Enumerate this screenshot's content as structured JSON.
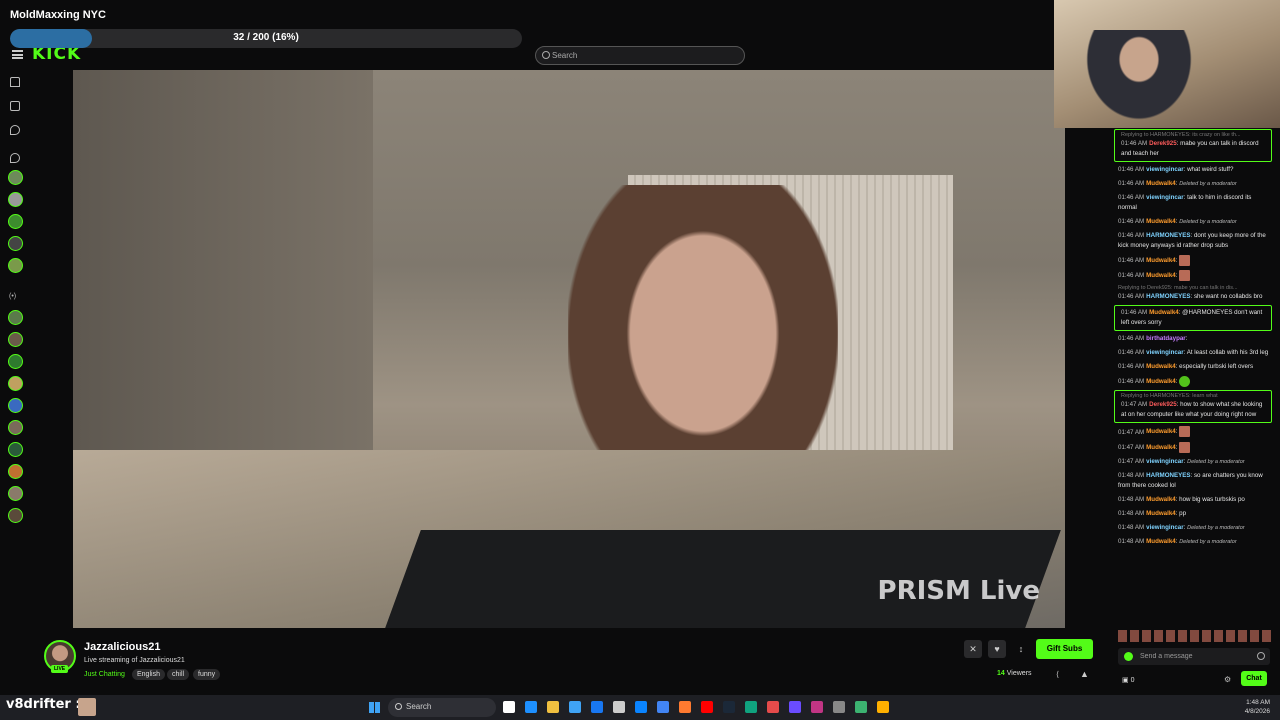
{
  "overlay": {
    "title": "MoldMaxxing NYC",
    "goal_text": "32 / 200 (16%)",
    "goal_progress": 0.16
  },
  "header": {
    "logo": "KICK",
    "search_placeholder": "Search"
  },
  "sidebar": {
    "live_label": "(•)"
  },
  "video": {
    "watermark": "PRISM Live"
  },
  "streamer": {
    "name": "Jazzalicious21",
    "live_badge": "LIVE",
    "title": "Live streaming of Jazzalicious21",
    "category": "Just Chatting",
    "tags": [
      "English",
      "chill",
      "funny"
    ],
    "gift_button": "Gift Subs",
    "viewers_count": "14",
    "viewers_label": "Viewers"
  },
  "chat": {
    "messages": [
      {
        "reply": "Replying to HARMONEYES: its crazy on like th...",
        "ts": "01:46 AM",
        "user": "Derek925",
        "color": "#ff5c5c",
        "text": ": mabe you can talk in discord and teach her",
        "hl": true
      },
      {
        "ts": "01:46 AM",
        "user": "viewingincar",
        "color": "#7fd3ff",
        "text": ": what weird stuff?"
      },
      {
        "ts": "01:46 AM",
        "user": "Mudwalk4",
        "color": "#ff9d2e",
        "text": ":",
        "deleted": "Deleted by a moderator"
      },
      {
        "ts": "01:46 AM",
        "user": "viewingincar",
        "color": "#7fd3ff",
        "text": ": talk to him in discord its normal"
      },
      {
        "ts": "01:46 AM",
        "user": "Mudwalk4",
        "color": "#ff9d2e",
        "text": ":",
        "deleted": "Deleted by a moderator"
      },
      {
        "ts": "01:46 AM",
        "user": "HARMONEYES",
        "color": "#7fd3ff",
        "text": ": dont you keep more of the kick money anyways id rather drop subs"
      },
      {
        "ts": "01:46 AM",
        "user": "Mudwalk4",
        "color": "#ff9d2e",
        "text": ":",
        "emote": true
      },
      {
        "ts": "01:46 AM",
        "user": "Mudwalk4",
        "color": "#ff9d2e",
        "text": ":",
        "emote": true
      },
      {
        "reply": "Replying to Derek925: mabe you can talk in dis...",
        "ts": "01:46 AM",
        "user": "HARMONEYES",
        "color": "#7fd3ff",
        "text": ": she want no collabds bro"
      },
      {
        "ts": "01:46 AM",
        "user": "Mudwalk4",
        "color": "#ff9d2e",
        "text": ": @HARMONEYES don't want left overs sorry",
        "hl": true
      },
      {
        "ts": "01:46 AM",
        "user": "birthatdaypar",
        "color": "#c77dff",
        "text": ":"
      },
      {
        "ts": "01:46 AM",
        "user": "viewingincar",
        "color": "#7fd3ff",
        "text": ": At least collab with his 3rd leg"
      },
      {
        "ts": "01:46 AM",
        "user": "Mudwalk4",
        "color": "#ff9d2e",
        "text": ": especially turbski left overs"
      },
      {
        "ts": "01:46 AM",
        "user": "Mudwalk4",
        "color": "#ff9d2e",
        "text": ":",
        "emote": true,
        "green": true
      },
      {
        "reply": "Replying to HARMONEYES: learn what",
        "ts": "01:47 AM",
        "user": "Derek925",
        "color": "#ff5c5c",
        "text": ": how to show what she looking at on her computer like what your doing right now",
        "hl": true
      },
      {
        "ts": "01:47 AM",
        "user": "Mudwalk4",
        "color": "#ff9d2e",
        "text": ":",
        "emote": true
      },
      {
        "ts": "01:47 AM",
        "user": "Mudwalk4",
        "color": "#ff9d2e",
        "text": ":",
        "emote": true
      },
      {
        "ts": "01:47 AM",
        "user": "viewingincar",
        "color": "#7fd3ff",
        "text": ":",
        "deleted": "Deleted by a moderator"
      },
      {
        "ts": "01:48 AM",
        "user": "HARMONEYES",
        "color": "#7fd3ff",
        "text": ": so are chatters you know from there cooked lol"
      },
      {
        "ts": "01:48 AM",
        "user": "Mudwalk4",
        "color": "#ff9d2e",
        "text": ": how big was turbskis po"
      },
      {
        "ts": "01:48 AM",
        "user": "Mudwalk4",
        "color": "#ff9d2e",
        "text": ": pp"
      },
      {
        "ts": "01:48 AM",
        "user": "viewingincar",
        "color": "#7fd3ff",
        "text": ":",
        "deleted": "Deleted by a moderator"
      },
      {
        "ts": "01:48 AM",
        "user": "Mudwalk4",
        "color": "#ff9d2e",
        "text": ":",
        "deleted": "Deleted by a moderator"
      }
    ],
    "input_placeholder": "Send a message",
    "points": "0",
    "send_button": "Chat"
  },
  "taskbar": {
    "handle": "v8drifter :",
    "search_label": "Search",
    "time": "1:48 AM",
    "date": "4/8/2026",
    "app_colors": [
      "#ffffff",
      "#1e90ff",
      "#f0c040",
      "#3fa3f5",
      "#1877f2",
      "#cccccc",
      "#0a84ff",
      "#4285f4",
      "#ff7a30",
      "#ff0000",
      "#1b2838",
      "#10a37f",
      "#e54b4b",
      "#6a4cff",
      "#c13584",
      "#888888",
      "#3cb371",
      "#ffb000"
    ]
  }
}
